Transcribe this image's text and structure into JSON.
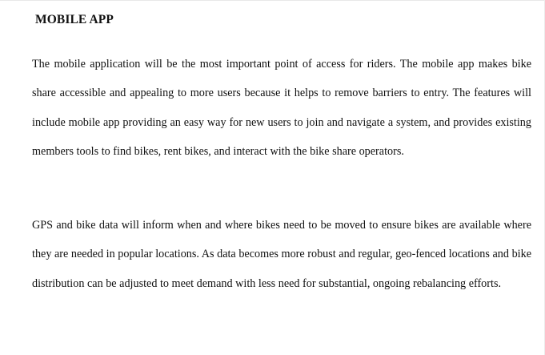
{
  "document": {
    "heading": "MOBILE APP",
    "paragraphs": [
      "The mobile application will be the most important point of access for riders. The mobile app makes bike share accessible and appealing to more users because it helps to remove barriers to entry. The features will include mobile app providing an easy way for new users to join and navigate a system, and provides existing members tools to find bikes, rent bikes, and interact with the bike share operators.",
      "GPS and bike data will inform when and where bikes need to be moved to ensure bikes are available where they are needed in popular locations. As data becomes more robust and regular, geo-fenced locations and bike distribution can be adjusted to meet demand with less need for substantial, ongoing rebalancing efforts."
    ]
  }
}
